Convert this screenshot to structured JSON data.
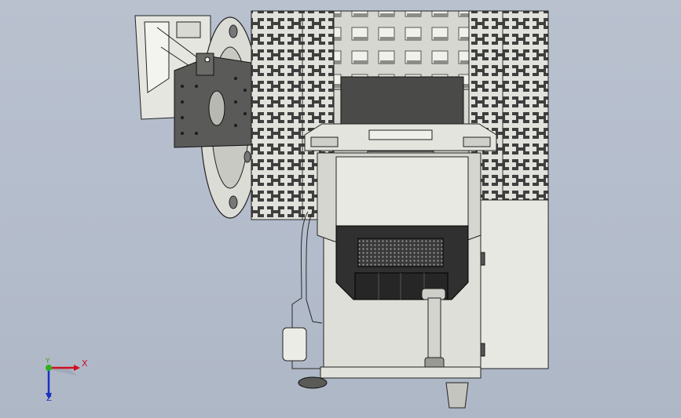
{
  "viewport": {
    "background_color": "#b6bfcd",
    "model_name": "drum-machine-assembly"
  },
  "triad": {
    "x_label": "X",
    "y_label": "Y",
    "z_label": "Z",
    "x_color": "#d01020",
    "y_color": "#30b020",
    "z_color": "#1830c0"
  }
}
